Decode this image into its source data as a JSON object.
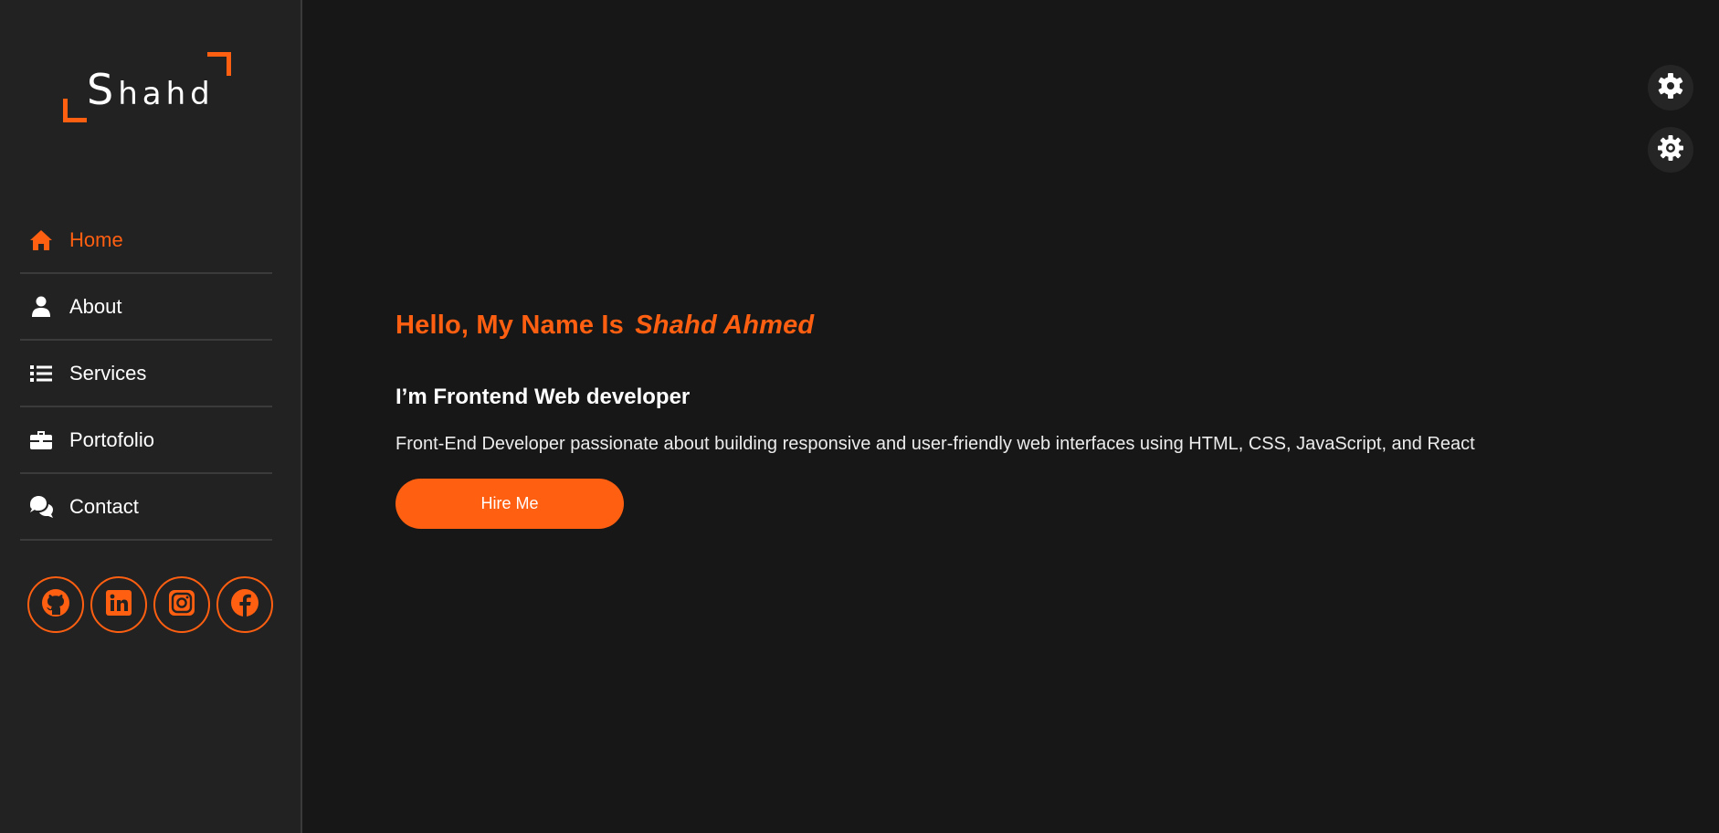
{
  "brand": {
    "logo_first_letter": "S",
    "logo_rest": "hahd",
    "accent_color": "#ff5f11",
    "background_color": "#171717",
    "sidebar_color": "#222222"
  },
  "nav": {
    "items": [
      {
        "label": "Home",
        "icon": "home-icon",
        "active": true
      },
      {
        "label": "About",
        "icon": "user-icon",
        "active": false
      },
      {
        "label": "Services",
        "icon": "list-icon",
        "active": false
      },
      {
        "label": "Portofolio",
        "icon": "briefcase-icon",
        "active": false
      },
      {
        "label": "Contact",
        "icon": "chat-icon",
        "active": false
      }
    ]
  },
  "socials": [
    {
      "icon": "github-icon"
    },
    {
      "icon": "linkedin-icon"
    },
    {
      "icon": "instagram-icon"
    },
    {
      "icon": "facebook-icon"
    }
  ],
  "hero": {
    "greeting": "Hello, My Name Is",
    "name": "Shahd  Ahmed",
    "role": "I’m Frontend Web developer",
    "description": "Front-End Developer passionate about building responsive and user-friendly web interfaces using HTML, CSS, JavaScript, and React",
    "cta_label": "Hire Me"
  },
  "settings": [
    {
      "icon": "settings-gear-icon"
    },
    {
      "icon": "theme-gear-icon"
    }
  ]
}
